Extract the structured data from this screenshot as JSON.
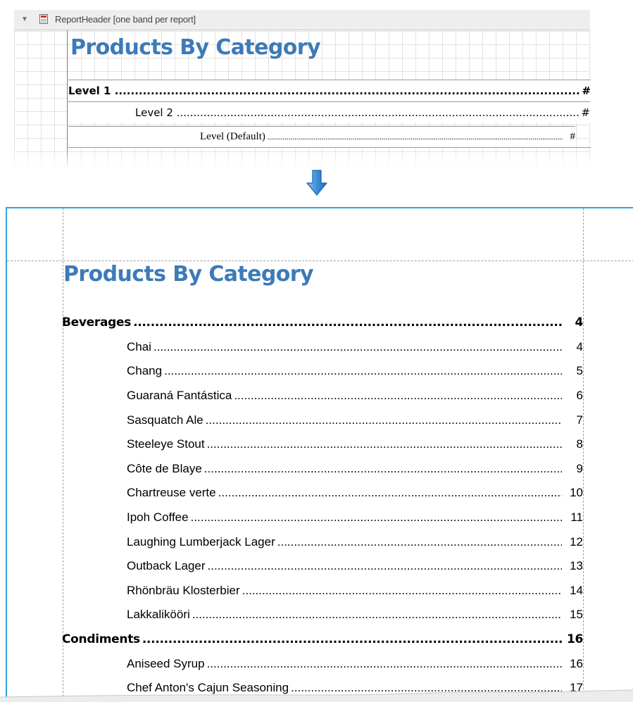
{
  "designer": {
    "band_header": {
      "collapse_icon": "triangle-down-icon",
      "band_icon": "report-header-band-icon",
      "label": "ReportHeader [one band per report]"
    },
    "toc_title": "Products By Category",
    "levels": [
      {
        "label": "Level 1",
        "page": "#"
      },
      {
        "label": "Level 2",
        "page": "#"
      },
      {
        "label": "Level (Default)",
        "page": "#"
      }
    ]
  },
  "arrow_icon": "arrow-down-icon",
  "preview": {
    "toc_title": "Products By Category",
    "entries": [
      {
        "level": 1,
        "label": "Beverages",
        "page": "4"
      },
      {
        "level": 2,
        "label": "Chai",
        "page": "4"
      },
      {
        "level": 2,
        "label": "Chang",
        "page": "5"
      },
      {
        "level": 2,
        "label": "Guaraná Fantástica",
        "page": "6"
      },
      {
        "level": 2,
        "label": "Sasquatch Ale",
        "page": "7"
      },
      {
        "level": 2,
        "label": "Steeleye Stout",
        "page": "8"
      },
      {
        "level": 2,
        "label": "Côte de Blaye",
        "page": "9"
      },
      {
        "level": 2,
        "label": "Chartreuse verte",
        "page": "10"
      },
      {
        "level": 2,
        "label": "Ipoh Coffee",
        "page": "11"
      },
      {
        "level": 2,
        "label": "Laughing Lumberjack Lager",
        "page": "12"
      },
      {
        "level": 2,
        "label": "Outback Lager",
        "page": "13"
      },
      {
        "level": 2,
        "label": "Rhönbräu Klosterbier",
        "page": "14"
      },
      {
        "level": 2,
        "label": "Lakkalikööri",
        "page": "15"
      },
      {
        "level": 1,
        "label": "Condiments",
        "page": "16"
      },
      {
        "level": 2,
        "label": "Aniseed Syrup",
        "page": "16"
      },
      {
        "level": 2,
        "label": "Chef Anton's Cajun Seasoning",
        "page": "17"
      }
    ]
  },
  "colors": {
    "title": "#3d7ab8",
    "preview_border": "#2ca3e0",
    "arrow": "#3b8fd8"
  }
}
